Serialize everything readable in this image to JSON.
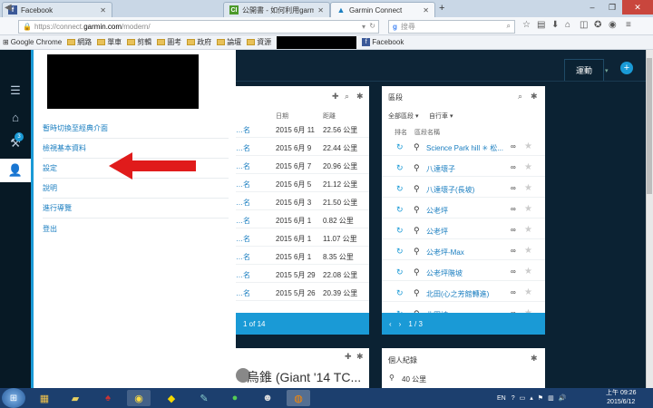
{
  "browser": {
    "tabs": [
      {
        "title": "Facebook",
        "active": false,
        "icon": "facebook-icon"
      },
      {
        "title": "公開書 - 如何利用garmin...",
        "active": false,
        "icon": "crossword-icon"
      },
      {
        "title": "Garmin Connect",
        "active": true,
        "icon": "garmin-icon"
      }
    ],
    "url": {
      "prefix": "https://connect.",
      "domain": "garmin.com",
      "path": "/modern/"
    },
    "search_placeholder": "搜尋",
    "bookmarks": [
      {
        "label": "Google Chrome",
        "type": "grid"
      },
      {
        "label": "網路",
        "type": "folder"
      },
      {
        "label": "單車",
        "type": "folder"
      },
      {
        "label": "剪輯",
        "type": "folder"
      },
      {
        "label": "圖考",
        "type": "folder"
      },
      {
        "label": "政府",
        "type": "folder"
      },
      {
        "label": "論壇",
        "type": "folder"
      },
      {
        "label": "資源",
        "type": "folder"
      },
      {
        "label": "Facebook",
        "type": "facebook"
      }
    ]
  },
  "garmin": {
    "nav_tab": "運動",
    "badge_count": "3",
    "menu_items": [
      "暫時切換至經典介面",
      "檢視基本資料",
      "設定",
      "說明",
      "進行導覽",
      "登出"
    ],
    "activities": {
      "header_date": "日期",
      "header_distance": "距離",
      "rows": [
        {
          "name": "…名",
          "date": "2015 6月 11",
          "distance": "22.56 公里"
        },
        {
          "name": "…名",
          "date": "2015 6月 9",
          "distance": "22.44 公里"
        },
        {
          "name": "…名",
          "date": "2015 6月 7",
          "distance": "20.96 公里"
        },
        {
          "name": "…名",
          "date": "2015 6月 5",
          "distance": "21.12 公里"
        },
        {
          "name": "…名",
          "date": "2015 6月 3",
          "distance": "21.50 公里"
        },
        {
          "name": "…名",
          "date": "2015 6月 1",
          "distance": "0.82 公里"
        },
        {
          "name": "…名",
          "date": "2015 6月 1",
          "distance": "11.07 公里"
        },
        {
          "name": "…名",
          "date": "2015 6月 1",
          "distance": "8.35 公里"
        },
        {
          "name": "…名",
          "date": "2015 5月 29",
          "distance": "22.08 公里"
        },
        {
          "name": "…名",
          "date": "2015 5月 26",
          "distance": "20.39 公里"
        }
      ],
      "pager": "1 of 14"
    },
    "segments": {
      "title": "區段",
      "filter_all": "全部區段 ▾",
      "filter_type": "自行車 ▾",
      "col_rank": "排名",
      "col_name": "區段名稱",
      "rows": [
        "Science Park hill ✳ 松...",
        "八達壞子",
        "八達壞子(長坡)",
        "公老坪",
        "公老坪",
        "公老坪-Max",
        "公老坪階坡",
        "北田(心之芳館轉進)",
        "北田坡"
      ],
      "pager": "1 / 3"
    },
    "bike_card": {
      "title": "烏錐 (Giant '14 TC..."
    },
    "records_card": {
      "title": "個人紀錄",
      "value": "40 公里"
    }
  },
  "taskbar": {
    "lang": "EN",
    "time": "上午 09:26",
    "date": "2015/6/12"
  }
}
